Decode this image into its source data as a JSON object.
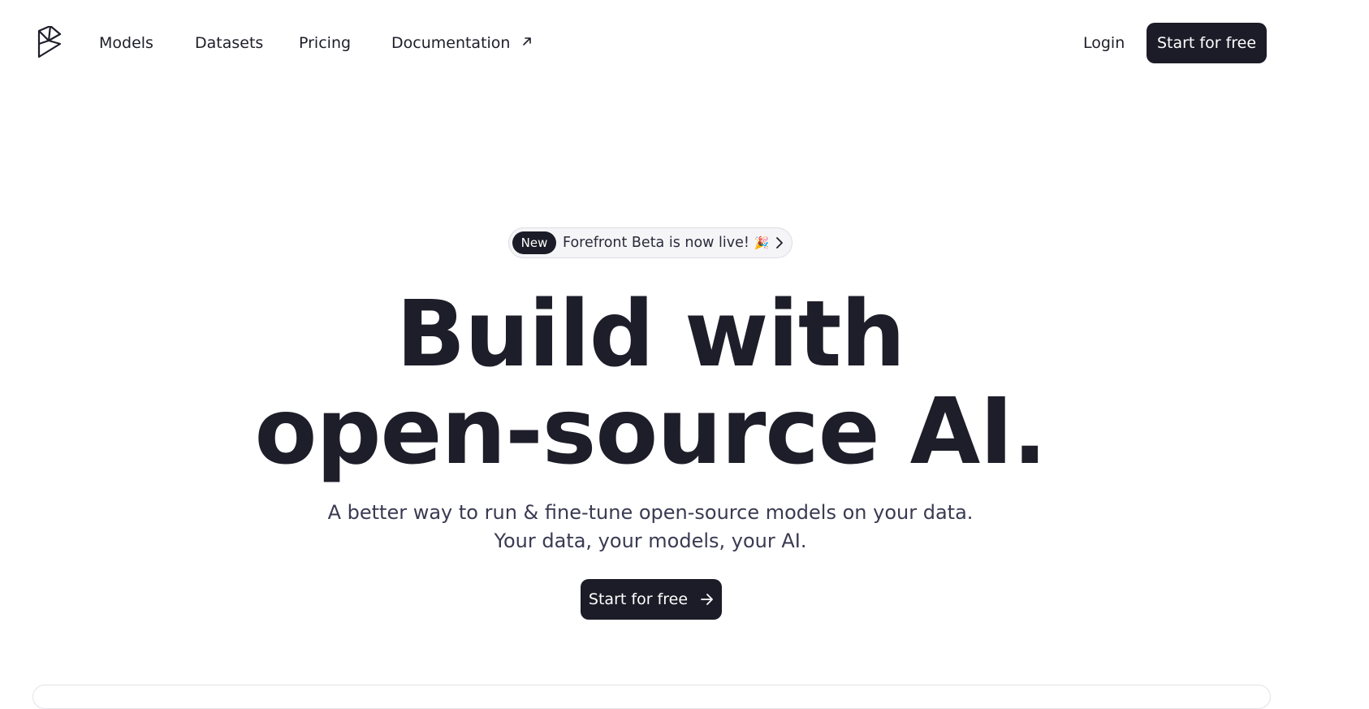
{
  "nav": {
    "logo_icon": "forefront-logo-icon",
    "links": {
      "models": "Models",
      "datasets": "Datasets",
      "pricing": "Pricing",
      "documentation": "Documentation"
    },
    "external_icon": "arrow-up-right-icon",
    "login": "Login",
    "cta": "Start for free"
  },
  "announcement": {
    "badge": "New",
    "text": "Forefront Beta is now live!",
    "emoji": "🎉",
    "chevron_icon": "chevron-right-icon"
  },
  "hero": {
    "title_line1": "Build with",
    "title_line2": "open-source AI.",
    "subtitle_line1": "A better way to run & fine-tune open-source models on your data.",
    "subtitle_line2": "Your data, your models, your AI.",
    "cta": "Start for free",
    "cta_icon": "arrow-right-icon"
  },
  "colors": {
    "primary_dark": "#1c1c28",
    "text": "#1e1e2a",
    "muted_text": "#3a3a52",
    "background": "#ffffff"
  }
}
